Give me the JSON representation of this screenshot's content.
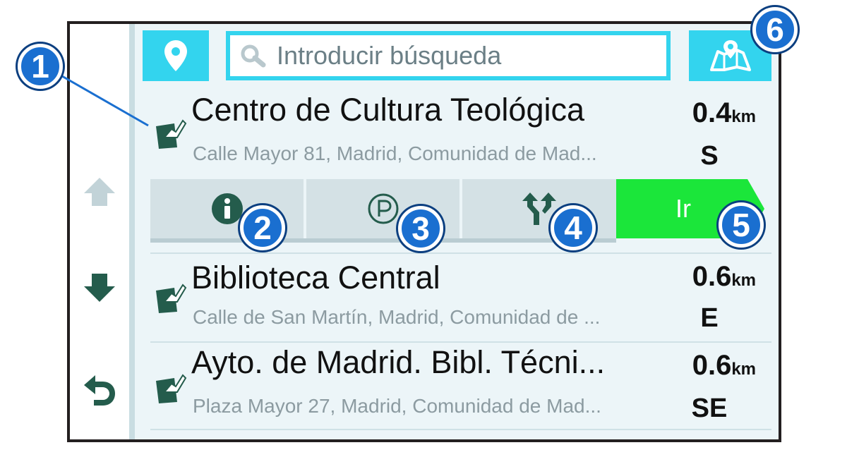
{
  "sidebar": {
    "up_icon": "arrow-up-icon",
    "down_icon": "arrow-down-icon",
    "back_icon": "back-icon"
  },
  "topbar": {
    "location_icon": "map-pin-icon",
    "search": {
      "placeholder": "Introducir búsqueda",
      "icon": "search-icon"
    },
    "map_icon": "map-icon"
  },
  "results": [
    {
      "name": "Centro de Cultura Teológica",
      "address": "Calle Mayor 81, Madrid, Comunidad de Mad...",
      "distance": "0.4",
      "unit": "km",
      "direction": "S"
    },
    {
      "name": "Biblioteca Central",
      "address": "Calle de San Martín, Madrid, Comunidad de ...",
      "distance": "0.6",
      "unit": "km",
      "direction": "E"
    },
    {
      "name": "Ayto. de Madrid. Bibl. Técni...",
      "address": "Plaza Mayor 27, Madrid, Comunidad de Mad...",
      "distance": "0.6",
      "unit": "km",
      "direction": "SE"
    }
  ],
  "actions": {
    "info_icon": "info-icon",
    "parking_icon": "parking-icon",
    "route_icon": "route-fork-icon",
    "go_label": "Ir"
  },
  "callouts": [
    "1",
    "2",
    "3",
    "4",
    "5",
    "6"
  ],
  "colors": {
    "accent": "#33d4ee",
    "go": "#1be63a",
    "callout": "#1a6fd0",
    "icon": "#245c4c"
  }
}
